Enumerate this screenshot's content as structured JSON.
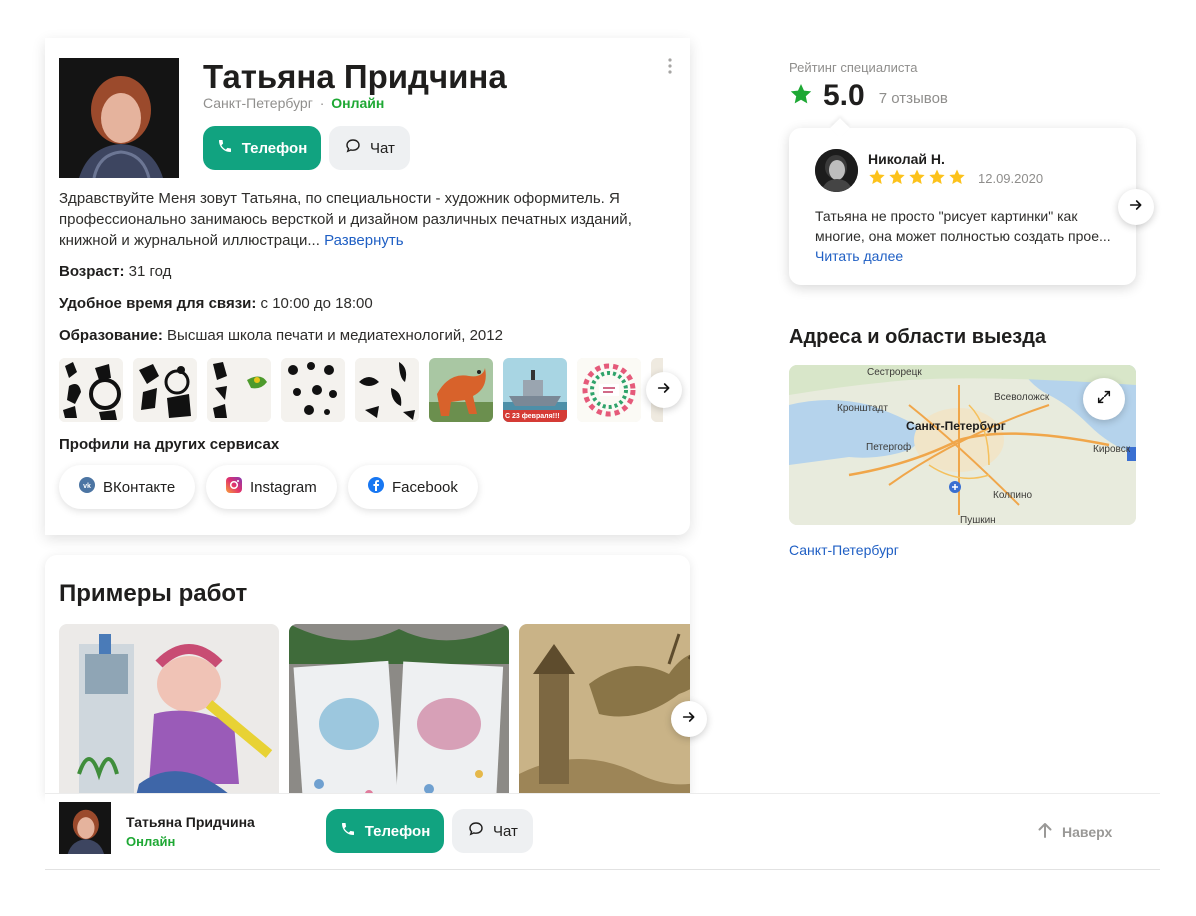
{
  "profile": {
    "name": "Татьяна Придчина",
    "city": "Санкт-Петербург",
    "separator": "·",
    "status": "Онлайн",
    "buttons": {
      "phone": "Телефон",
      "chat": "Чат"
    },
    "description": "Здравствуйте Меня зовут Татьяна, по специальности - художник оформитель. Я профессионально занимаюсь версткой и дизайном различных печатных изданий, книжной и журнальной иллюстраци...",
    "expand_link": "Развернуть",
    "age_label": "Возраст:",
    "age_value": "31 год",
    "time_label": "Удобное время для связи:",
    "time_value": "с 10:00 до 18:00",
    "education_label": "Образование:",
    "education_value": "Высшая школа печати и медиатехнологий, 2012",
    "thumb_caption_1": "С 23 февраля!!!",
    "profiles_title": "Профили на других сервисах",
    "socials": [
      "ВКонтакте",
      "Instagram",
      "Facebook"
    ]
  },
  "works": {
    "title": "Примеры работ"
  },
  "rating": {
    "label": "Рейтинг специалиста",
    "value": "5.0",
    "count": "7 отзывов",
    "accent": "#1ea834"
  },
  "review": {
    "author": "Николай Н.",
    "stars": 5,
    "date": "12.09.2020",
    "text": "Татьяна не просто \"рисует картинки\" как многие, она может полностью создать прое...",
    "read_more": "Читать далее",
    "star_color": "#fcc21b"
  },
  "addresses": {
    "title": "Адреса и области выезда",
    "map_labels": {
      "sestroretsk": "Сестрорецк",
      "vsevolozhsk": "Всеволожск",
      "kronshtadt": "Кронштадт",
      "spb": "Санкт-Петербург",
      "peterhof": "Петергоф",
      "kirovsk": "Кировск",
      "kolpino": "Колпино",
      "pushkin": "Пушкин"
    },
    "city_link": "Санкт-Петербург"
  },
  "bottom_bar": {
    "name": "Татьяна Придчина",
    "status": "Онлайн",
    "phone": "Телефон",
    "chat": "Чат",
    "up": "Наверх"
  },
  "colors": {
    "primary_green": "#11a380",
    "online_green": "#1ea834",
    "link_blue": "#1f5fc4"
  }
}
